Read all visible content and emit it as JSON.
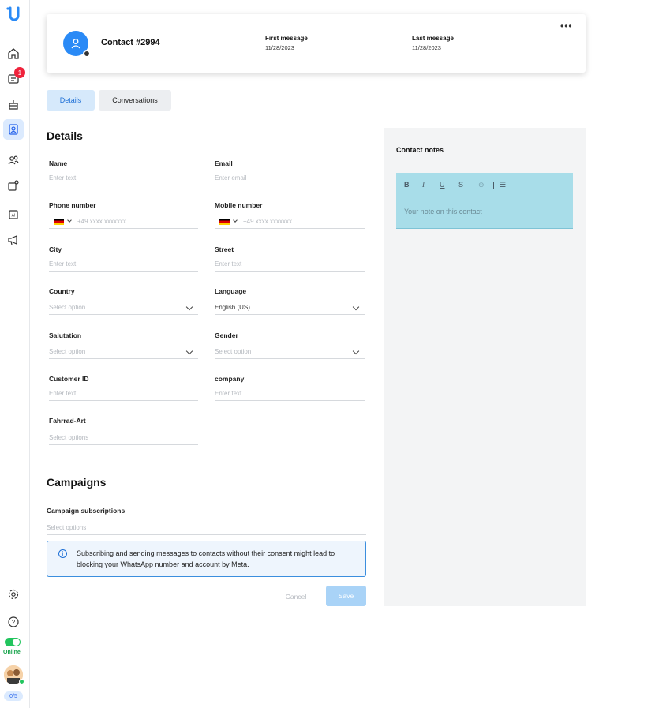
{
  "sidebar": {
    "badge_count": "1",
    "status_label": "Online",
    "count_pill": "0/5",
    "icons": [
      "logo-icon",
      "home-icon",
      "inbox-icon",
      "cake-icon",
      "contacts-icon",
      "team-icon",
      "integrations-icon",
      "ai-icon",
      "megaphone-icon",
      "gear-icon",
      "help-icon"
    ]
  },
  "contact": {
    "name": "Contact #2994",
    "first_message_label": "First message",
    "first_message_value": "11/28/2023",
    "last_message_label": "Last message",
    "last_message_value": "11/28/2023",
    "more_label": "•••"
  },
  "tabs": [
    {
      "label": "Details",
      "active": true
    },
    {
      "label": "Conversations",
      "active": false
    }
  ],
  "details": {
    "title": "Details",
    "fields": {
      "name": {
        "label": "Name",
        "placeholder": "Enter text"
      },
      "email": {
        "label": "Email",
        "placeholder": "Enter email"
      },
      "phone": {
        "label": "Phone number",
        "placeholder": "+49 xxxx xxxxxxx"
      },
      "mobile": {
        "label": "Mobile number",
        "placeholder": "+49 xxxx xxxxxxx"
      },
      "city": {
        "label": "City",
        "placeholder": "Enter text"
      },
      "street": {
        "label": "Street",
        "placeholder": "Enter text"
      },
      "country": {
        "label": "Country",
        "placeholder": "Select option"
      },
      "language": {
        "label": "Language",
        "value": "English (US)"
      },
      "salutation": {
        "label": "Salutation",
        "placeholder": "Select option"
      },
      "gender": {
        "label": "Gender",
        "placeholder": "Select option"
      },
      "customer_id": {
        "label": "Customer ID",
        "placeholder": "Enter text"
      },
      "company": {
        "label": "company",
        "placeholder": "Enter text"
      },
      "fahrrad": {
        "label": "Fahrrad-Art",
        "placeholder": "Select options"
      }
    }
  },
  "campaigns": {
    "title": "Campaigns",
    "subscriptions_label": "Campaign subscriptions",
    "subscriptions_placeholder": "Select options",
    "alert_text": "Subscribing and sending messages to contacts without their consent might lead to blocking your WhatsApp number and account by Meta.",
    "cancel_label": "Cancel",
    "save_label": "Save"
  },
  "notes": {
    "title": "Contact notes",
    "placeholder": "Your note on this contact",
    "toolbar": {
      "bold": "B",
      "italic": "I",
      "underline": "U",
      "strike": "S",
      "link": "⊖",
      "list": "☰",
      "more": "···"
    }
  },
  "colors": {
    "accent": "#2a8af6",
    "notes_bg": "#a8dde9",
    "online": "#22c55e",
    "badge": "#ef233c"
  }
}
